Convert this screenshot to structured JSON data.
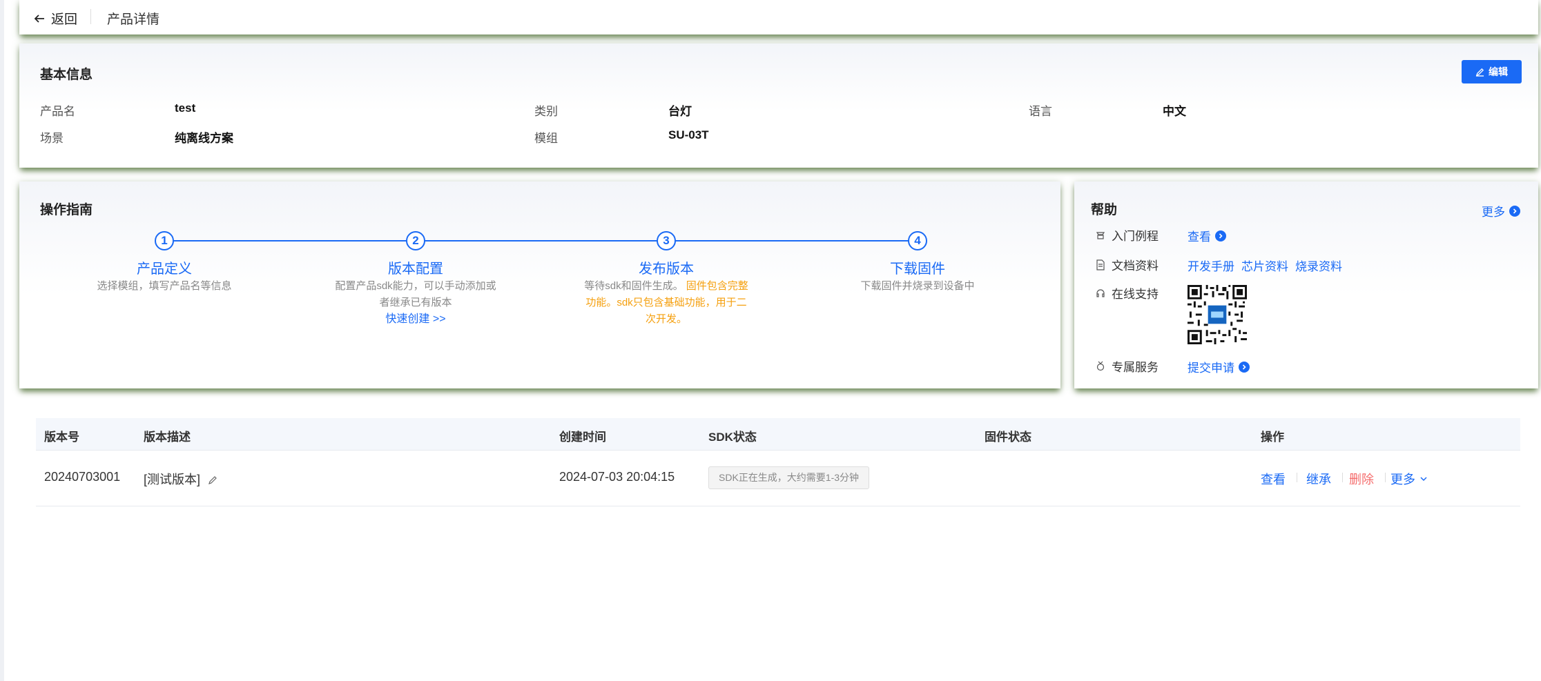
{
  "topbar": {
    "back_label": "返回",
    "breadcrumb": "产品详情"
  },
  "basic": {
    "title": "基本信息",
    "edit_label": "编辑",
    "fields": [
      {
        "label": "产品名",
        "value": "test"
      },
      {
        "label": "类别",
        "value": "台灯"
      },
      {
        "label": "语言",
        "value": "中文"
      },
      {
        "label": "场景",
        "value": "纯离线方案"
      },
      {
        "label": "模组",
        "value": "SU-03T"
      }
    ]
  },
  "guide": {
    "title": "操作指南",
    "steps": [
      {
        "num": "1",
        "title": "产品定义",
        "desc": "选择模组，填写产品名等信息"
      },
      {
        "num": "2",
        "title": "版本配置",
        "desc": "配置产品sdk能力，可以手动添加或者继承已有版本",
        "link": "快速创建 >>"
      },
      {
        "num": "3",
        "title": "发布版本",
        "desc": "等待sdk和固件生成。",
        "desc_highlight": "固件包含完整功能。sdk只包含基础功能，用于二次开发。"
      },
      {
        "num": "4",
        "title": "下载固件",
        "desc": "下载固件并烧录到设备中"
      }
    ]
  },
  "help": {
    "title": "帮助",
    "more_label": "更多",
    "rows": [
      {
        "label": "入门例程",
        "icon": "tutorial-icon",
        "links": [
          "查看"
        ]
      },
      {
        "label": "文档资料",
        "icon": "document-icon",
        "links": [
          "开发手册",
          "芯片资料",
          "烧录资料"
        ]
      },
      {
        "label": "在线支持",
        "icon": "headset-icon"
      },
      {
        "label": "专属服务",
        "icon": "medal-icon",
        "links": [
          "提交申请"
        ]
      }
    ]
  },
  "table": {
    "headers": [
      "版本号",
      "版本描述",
      "创建时间",
      "SDK状态",
      "固件状态",
      "操作"
    ],
    "rows": [
      {
        "version": "20240703001",
        "description": "[测试版本]",
        "created": "2024-07-03 20:04:15",
        "sdk_status": "SDK正在生成，大约需要1-3分钟",
        "firmware_status": "",
        "actions": [
          "查看",
          "继承",
          "删除",
          "更多"
        ]
      }
    ]
  },
  "colors": {
    "accent": "#1a6af5",
    "warning": "#f5a00f",
    "danger": "#f56c6c"
  }
}
